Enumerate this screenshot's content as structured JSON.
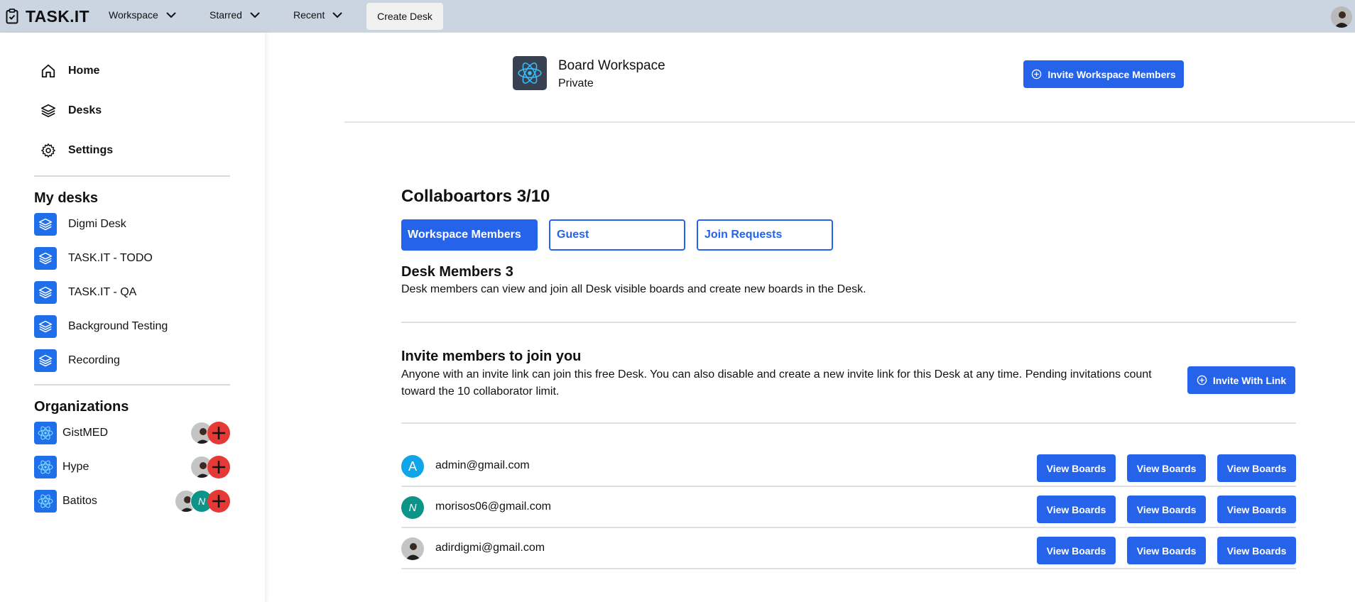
{
  "topbar": {
    "brand": "TASK.IT",
    "nav": [
      "Workspace",
      "Starred",
      "Recent"
    ],
    "create_desk": "Create Desk"
  },
  "sidebar": {
    "nav": [
      {
        "label": "Home",
        "icon": "home-icon"
      },
      {
        "label": "Desks",
        "icon": "layers-icon"
      },
      {
        "label": "Settings",
        "icon": "gear-icon"
      }
    ],
    "my_desks_title": "My desks",
    "desks": [
      "Digmi Desk",
      "TASK.IT - TODO",
      "TASK.IT - QA",
      "Background Testing",
      "Recording"
    ],
    "organizations_title": "Organizations",
    "organizations": [
      "GistMED",
      "Hype",
      "Batitos"
    ]
  },
  "workspace": {
    "title": "Board Workspace",
    "visibility": "Private",
    "invite_button": "Invite Workspace Members"
  },
  "collaborators": {
    "title": "Collaboartors 3/10",
    "tabs": [
      "Workspace Members",
      "Guest",
      "Join Requests"
    ],
    "desk_members_title": "Desk Members 3",
    "desk_members_desc": "Desk members can view and join all Desk visible boards and create new boards in the Desk.",
    "invite_title": "Invite members to join you",
    "invite_desc": "Anyone with an invite link can join this free Desk. You can also disable and create a new invite link for this Desk at any time. Pending invitations count toward the 10 collaborator limit.",
    "invite_link_button": "Invite With Link"
  },
  "members": [
    {
      "email": "admin@gmail.com",
      "initial": "A",
      "color": "#0ea5e9"
    },
    {
      "email": "morisos06@gmail.com",
      "initial": "N",
      "color": "#0d9488"
    },
    {
      "email": "adirdigmi@gmail.com",
      "initial": "",
      "color": ""
    }
  ],
  "view_boards_label": "View Boards",
  "colors": {
    "primary": "#2563eb",
    "topbar": "#cbd5e1",
    "danger": "#e53935"
  }
}
